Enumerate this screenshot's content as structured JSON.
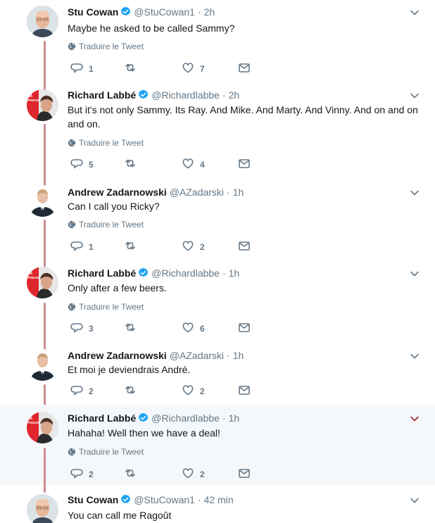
{
  "labels": {
    "translate": "Traduire le Tweet"
  },
  "colors": {
    "thread_line": "#cc8c92",
    "accent": "#1da1f2",
    "secondary_text": "#657786",
    "highlight_bg": "#f5f8fa"
  },
  "tweets": [
    {
      "author": "Stu Cowan",
      "verified": true,
      "handle": "@StuCowan1",
      "sep": "·",
      "time": "2h",
      "text": "Maybe he asked to be called Sammy?",
      "translate": true,
      "replies": "1",
      "retweets": "",
      "likes": "7",
      "avatar_icon": "bald-man-avatar-icon"
    },
    {
      "author": "Richard Labbé",
      "verified": true,
      "handle": "@Richardlabbe",
      "sep": "·",
      "time": "2h",
      "text": "But it's not only Sammy. Its Ray. And Mike. And Marty. And Vinny. And on and on and on.",
      "translate": true,
      "replies": "5",
      "retweets": "",
      "likes": "4",
      "avatar_badge": "LA PRESSE",
      "avatar_icon": "la-presse-avatar-icon"
    },
    {
      "author": "Andrew Zadarnowski",
      "verified": false,
      "handle": "@AZadarski",
      "sep": "·",
      "time": "1h",
      "text": "Can I call you Ricky?",
      "translate": true,
      "replies": "1",
      "retweets": "",
      "likes": "2",
      "avatar_icon": "suit-man-avatar-icon"
    },
    {
      "author": "Richard Labbé",
      "verified": true,
      "handle": "@Richardlabbe",
      "sep": "·",
      "time": "1h",
      "text": "Only after a few beers.",
      "translate": true,
      "replies": "3",
      "retweets": "",
      "likes": "6",
      "avatar_badge": "LA PRESSE",
      "avatar_icon": "la-presse-avatar-icon"
    },
    {
      "author": "Andrew Zadarnowski",
      "verified": false,
      "handle": "@AZadarski",
      "sep": "·",
      "time": "1h",
      "text": "Et moi je deviendrais André.",
      "translate": false,
      "replies": "2",
      "retweets": "",
      "likes": "2",
      "avatar_icon": "suit-man-avatar-icon"
    },
    {
      "author": "Richard Labbé",
      "verified": true,
      "handle": "@Richardlabbe",
      "sep": "·",
      "time": "1h",
      "text": "Hahaha! Well then we have a deal!",
      "translate": true,
      "replies": "2",
      "retweets": "",
      "likes": "2",
      "avatar_badge": "LA PRESSE",
      "avatar_icon": "la-presse-avatar-icon",
      "highlighted": true
    },
    {
      "author": "Stu Cowan",
      "verified": true,
      "handle": "@StuCowan1",
      "sep": "·",
      "time": "42 min",
      "text": "You can call me Ragoût",
      "translate": false,
      "replies": "",
      "retweets": "",
      "likes": "",
      "avatar_icon": "bald-man-avatar-icon"
    }
  ]
}
